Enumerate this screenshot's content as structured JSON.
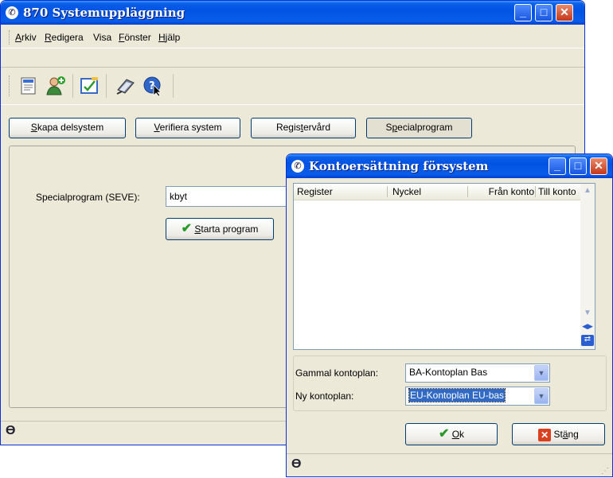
{
  "main_window": {
    "title": "870 Systemuppläggning",
    "menu": [
      {
        "label": "Arkiv",
        "accel": "A"
      },
      {
        "label": "Redigera",
        "accel": "R"
      },
      {
        "label": "Visa",
        "accel": ""
      },
      {
        "label": "Fönster",
        "accel": "F"
      },
      {
        "label": "Hjälp",
        "accel": "H"
      }
    ],
    "toolbar_icons": [
      "document-icon",
      "add-user-icon",
      "edit-note-icon",
      "book-pen-icon",
      "help-cursor-icon"
    ],
    "tabs": {
      "skapa": {
        "pre": "",
        "accel": "S",
        "post": "kapa delsystem"
      },
      "verifiera": {
        "pre": "",
        "accel": "V",
        "post": "erifiera system"
      },
      "registervard": {
        "pre": "Regis",
        "accel": "t",
        "post": "ervård"
      },
      "special": {
        "pre": "S",
        "accel": "p",
        "post": "ecialprogram"
      }
    },
    "special_label": "Specialprogram (SEVE):",
    "special_value": "kbyt",
    "start_button": {
      "pre": "",
      "accel": "S",
      "post": "tarta program"
    }
  },
  "dialog": {
    "title": "Kontoersättning försystem",
    "columns": [
      "Register",
      "Nyckel",
      "Från konto",
      "Till konto"
    ],
    "gammal_label": "Gammal kontoplan:",
    "gammal_value": "BA-Kontoplan Bas",
    "ny_label": "Ny kontoplan:",
    "ny_value": "EU-Kontoplan EU-bas",
    "ok_button": {
      "accel": "O",
      "post": "k"
    },
    "close_button": {
      "pre": "St",
      "accel": "ä",
      "post": "ng"
    }
  },
  "colors": {
    "title_blue": "#0054e3",
    "face": "#ece9d8",
    "selection": "#316ac5"
  }
}
